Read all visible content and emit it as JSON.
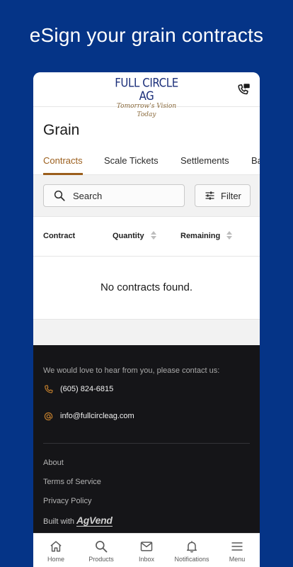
{
  "promo": {
    "title": "eSign your grain contracts"
  },
  "header": {
    "logo_main": "FULL CIRCLE AG",
    "logo_tagline": "Tomorrow's Vision Today",
    "phone_icon": "phone-message-icon"
  },
  "page": {
    "title": "Grain"
  },
  "tabs": [
    {
      "label": "Contracts",
      "active": true
    },
    {
      "label": "Scale Tickets",
      "active": false
    },
    {
      "label": "Settlements",
      "active": false
    },
    {
      "label": "Ba",
      "active": false
    }
  ],
  "search": {
    "label": "Search",
    "icon": "search-icon"
  },
  "filter": {
    "label": "Filter",
    "icon": "sliders-icon"
  },
  "table": {
    "columns": [
      {
        "label": "Contract",
        "sortable": false
      },
      {
        "label": "Quantity",
        "sortable": true
      },
      {
        "label": "Remaining",
        "sortable": true
      }
    ],
    "empty_message": "No contracts found."
  },
  "footer": {
    "intro": "We would love to hear from you, please contact us:",
    "phone": "(605) 824-6815",
    "email": "info@fullcircleag.com",
    "links": [
      "About",
      "Terms of Service",
      "Privacy Policy"
    ],
    "built_with": "Built with",
    "brand": "AgVend"
  },
  "nav": [
    {
      "label": "Home",
      "icon": "home-icon"
    },
    {
      "label": "Products",
      "icon": "search-icon"
    },
    {
      "label": "Inbox",
      "icon": "mail-icon"
    },
    {
      "label": "Notifications",
      "icon": "bell-icon"
    },
    {
      "label": "Menu",
      "icon": "menu-icon"
    }
  ],
  "colors": {
    "background": "#053487",
    "accent": "#9b5e1c",
    "footer_bg": "#151518",
    "logo_blue": "#1b2f7a"
  }
}
